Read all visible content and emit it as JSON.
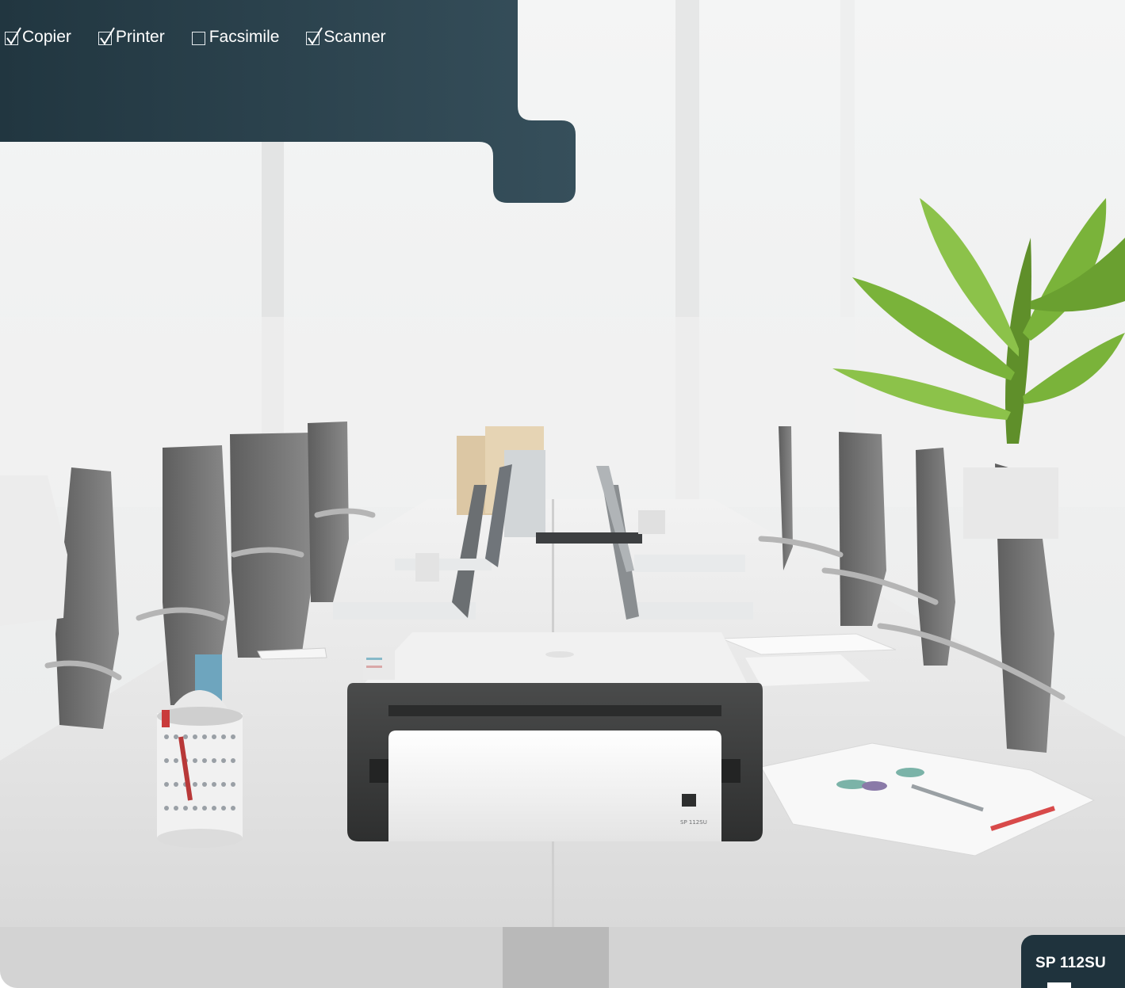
{
  "features": [
    {
      "label": "Copier",
      "checked": true
    },
    {
      "label": "Printer",
      "checked": true
    },
    {
      "label": "Facsimile",
      "checked": false
    },
    {
      "label": "Scanner",
      "checked": true
    }
  ],
  "model": {
    "name": "SP 112SU"
  },
  "printer_badge_text": "SP 112SU",
  "colors": {
    "panel": "#2e4855",
    "panel_dark": "#1f333d",
    "table": "#eaeaea",
    "printer_body": "#3c3d3d",
    "plant": "#7ab33a"
  }
}
